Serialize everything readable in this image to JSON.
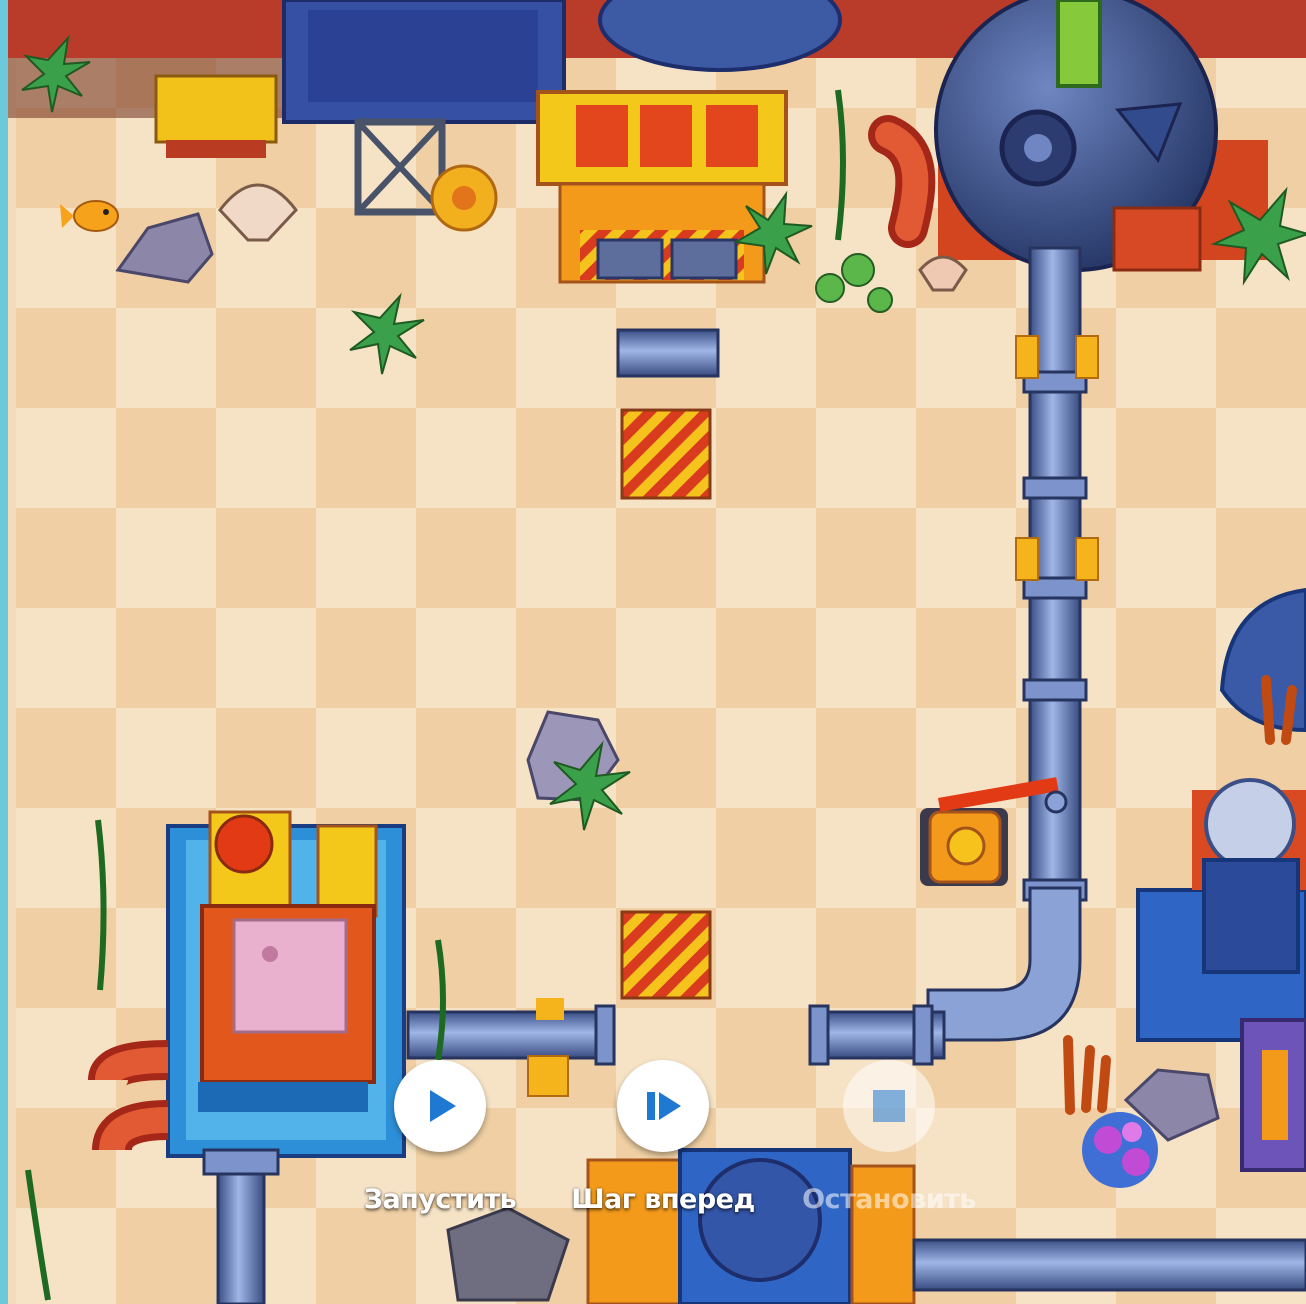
{
  "controls": {
    "run_label": "Запустить",
    "step_label": "Шаг вперед",
    "stop_label": "Остановить"
  },
  "icons": {
    "run": "play-icon",
    "step": "step-forward-icon",
    "stop": "stop-icon"
  },
  "colors": {
    "button_icon": "#1f78d1",
    "tile_light": "#f6e3c6",
    "tile_dark": "#efcfa3",
    "pipe": "#6a86c2",
    "hazard_red": "#d93b1e",
    "hazard_yellow": "#f6c21c"
  }
}
